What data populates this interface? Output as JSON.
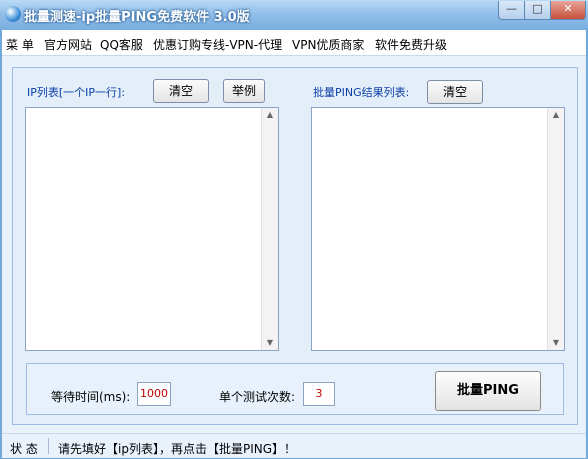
{
  "window": {
    "title": "批量测速-ip批量PING免费软件 3.0版",
    "minimize_glyph": "—",
    "maximize_glyph": "□",
    "close_glyph": "✕"
  },
  "menu": {
    "items": [
      "菜 单",
      "官方网站",
      "QQ客服",
      "优惠订购专线-VPN-代理",
      "VPN优质商家",
      "软件免费升级"
    ]
  },
  "ip_list": {
    "label": "IP列表[一个IP一行]:",
    "clear_button": "清空",
    "example_button": "举例",
    "value": ""
  },
  "result_list": {
    "label": "批量PING结果列表:",
    "clear_button": "清空",
    "value": ""
  },
  "settings": {
    "wait_time_label": "等待时间(ms):",
    "wait_time_value": "1000",
    "test_count_label": "单个测试次数:",
    "test_count_value": "3",
    "ping_button": "批量PING"
  },
  "status": {
    "label": "状 态",
    "text": "请先填好【ip列表】，再点击【批量PING】！"
  }
}
